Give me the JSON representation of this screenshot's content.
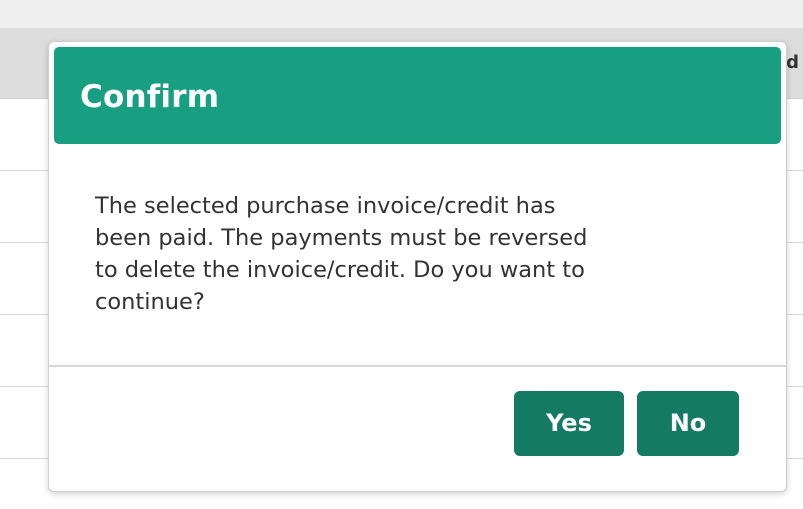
{
  "background": {
    "header_text": "d"
  },
  "dialog": {
    "title": "Confirm",
    "message_lines": [
      "The selected purchase invoice/credit has",
      "been paid. The payments must be reversed",
      "to delete the invoice/credit. Do you want to",
      "continue?"
    ],
    "buttons": {
      "yes": "Yes",
      "no": "No"
    }
  },
  "colors": {
    "header_bg": "#189f82",
    "button_bg": "#157a63",
    "text": "#333333"
  }
}
